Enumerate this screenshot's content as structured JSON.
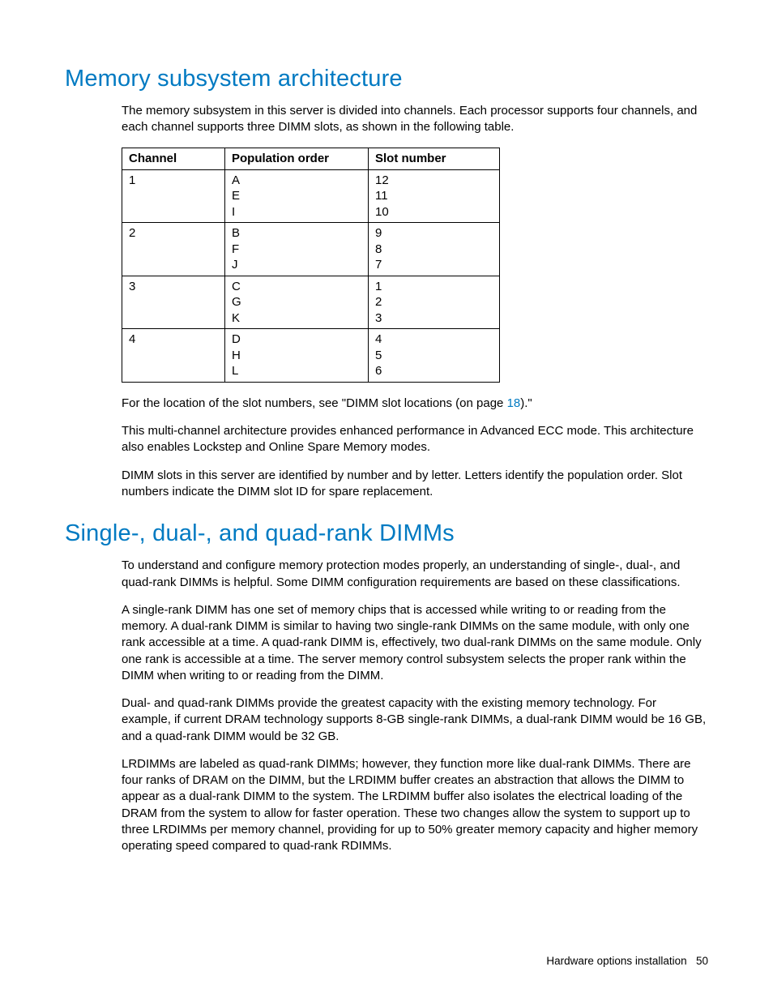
{
  "section1": {
    "title": "Memory subsystem architecture",
    "intro": "The memory subsystem in this server is divided into channels. Each processor supports four channels, and each channel supports three DIMM slots, as shown in the following table.",
    "table": {
      "headers": [
        "Channel",
        "Population order",
        "Slot number"
      ],
      "rows": [
        {
          "channel": "1",
          "pop": [
            "A",
            "E",
            "I"
          ],
          "slot": [
            "12",
            "11",
            "10"
          ]
        },
        {
          "channel": "2",
          "pop": [
            "B",
            "F",
            "J"
          ],
          "slot": [
            "9",
            "8",
            "7"
          ]
        },
        {
          "channel": "3",
          "pop": [
            "C",
            "G",
            "K"
          ],
          "slot": [
            "1",
            "2",
            "3"
          ]
        },
        {
          "channel": "4",
          "pop": [
            "D",
            "H",
            "L"
          ],
          "slot": [
            "4",
            "5",
            "6"
          ]
        }
      ]
    },
    "after_table_pre": "For the location of the slot numbers, see \"DIMM slot locations (on page ",
    "after_table_link": "18",
    "after_table_post": ").\"",
    "p2": "This multi-channel architecture provides enhanced performance in Advanced ECC mode. This architecture also enables Lockstep and Online Spare Memory modes.",
    "p3": "DIMM slots in this server are identified by number and by letter. Letters identify the population order. Slot numbers indicate the DIMM slot ID for spare replacement."
  },
  "section2": {
    "title": "Single-, dual-, and quad-rank DIMMs",
    "p1": "To understand and configure memory protection modes properly, an understanding of single-, dual-, and quad-rank DIMMs is helpful. Some DIMM configuration requirements are based on these classifications.",
    "p2": "A single-rank DIMM has one set of memory chips that is accessed while writing to or reading from the memory. A dual-rank DIMM is similar to having two single-rank DIMMs on the same module, with only one rank accessible at a time. A quad-rank DIMM is, effectively, two dual-rank DIMMs on the same module. Only one rank is accessible at a time. The server memory control subsystem selects the proper rank within the DIMM when writing to or reading from the DIMM.",
    "p3": "Dual- and quad-rank DIMMs provide the greatest capacity with the existing memory technology. For example, if current DRAM technology supports 8-GB single-rank DIMMs, a dual-rank DIMM would be 16 GB, and a quad-rank DIMM would be 32 GB.",
    "p4": "LRDIMMs are labeled as quad-rank DIMMs; however, they function more like dual-rank DIMMs. There are four ranks of DRAM on the DIMM, but the LRDIMM buffer creates an abstraction that allows the DIMM to appear as a dual-rank DIMM to the system. The LRDIMM buffer also isolates the electrical loading of the DRAM from the system to allow for faster operation. These two changes allow the system to support up to three LRDIMMs per memory channel, providing for up to 50% greater memory capacity and higher memory operating speed compared to quad-rank RDIMMs."
  },
  "footer": {
    "text": "Hardware options installation",
    "page": "50"
  }
}
